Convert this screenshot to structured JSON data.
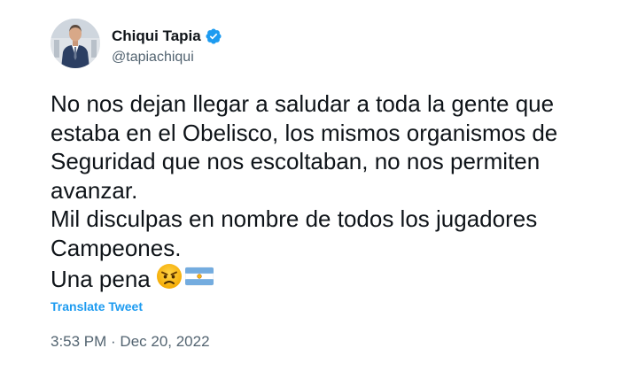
{
  "author": {
    "display_name": "Chiqui Tapia",
    "handle": "@tapiachiqui",
    "verified_icon": "verified-badge-icon",
    "verified_color": "#1d9bf0"
  },
  "tweet": {
    "lines": [
      "No nos dejan llegar a saludar a toda la gente que",
      "estaba en el Obelisco, los mismos organismos de",
      "Seguridad que nos escoltaban, no nos permiten",
      "avanzar.",
      "Mil disculpas en nombre de todos los jugadores",
      "Campeones."
    ],
    "last_line": "Una pena",
    "emojis": [
      "angry-face-icon",
      "argentina-flag-icon"
    ],
    "translate_label": "Translate Tweet",
    "timestamp": "3:53 PM · Dec 20, 2022"
  },
  "colors": {
    "text": "#0f1419",
    "secondary": "#536471",
    "link": "#1d9bf0"
  }
}
